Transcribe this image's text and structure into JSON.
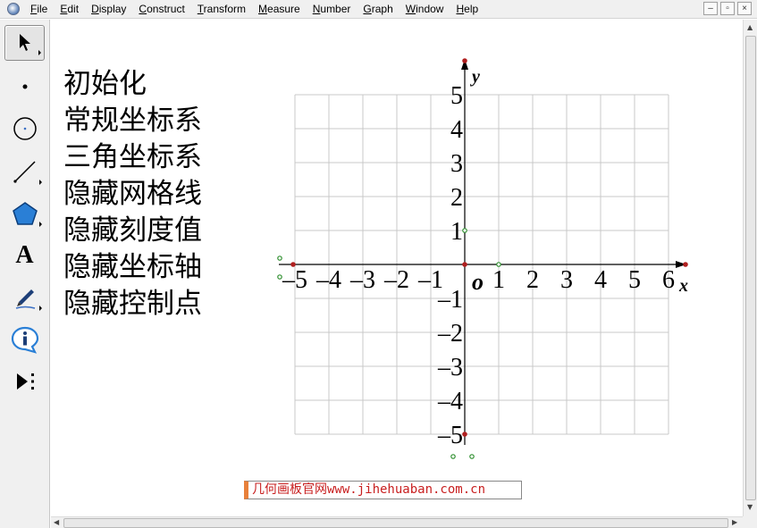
{
  "menu": {
    "items": [
      {
        "accel": "F",
        "rest": "ile"
      },
      {
        "accel": "E",
        "rest": "dit"
      },
      {
        "accel": "D",
        "rest": "isplay"
      },
      {
        "accel": "C",
        "rest": "onstruct"
      },
      {
        "accel": "T",
        "rest": "ransform"
      },
      {
        "accel": "M",
        "rest": "easure"
      },
      {
        "accel": "N",
        "rest": "umber"
      },
      {
        "accel": "G",
        "rest": "raph"
      },
      {
        "accel": "W",
        "rest": "indow"
      },
      {
        "accel": "H",
        "rest": "elp"
      }
    ],
    "window_controls": [
      "–",
      "▫",
      "×"
    ]
  },
  "toolbox": {
    "tools": [
      {
        "name": "arrow-tool",
        "icon": "arrow-select-icon",
        "selected": true
      },
      {
        "name": "point-tool",
        "icon": "point-icon"
      },
      {
        "name": "compass-tool",
        "icon": "circle-icon"
      },
      {
        "name": "straightedge-tool",
        "icon": "line-segment-icon"
      },
      {
        "name": "polygon-tool",
        "icon": "pentagon-icon"
      },
      {
        "name": "text-tool",
        "icon": "text-a-icon",
        "glyph": "A"
      },
      {
        "name": "marker-tool",
        "icon": "pen-marker-icon"
      },
      {
        "name": "information-tool",
        "icon": "info-icon",
        "glyph": "i"
      },
      {
        "name": "custom-tools",
        "icon": "custom-tool-icon"
      }
    ]
  },
  "action_buttons": [
    "初始化",
    "常规坐标系",
    "三角坐标系",
    "隐藏网格线",
    "隐藏刻度值",
    "隐藏坐标轴",
    "隐藏控制点"
  ],
  "graph": {
    "x_tick_labels": [
      "–5",
      "–4",
      "–3",
      "–2",
      "–1",
      "1",
      "2",
      "3",
      "4",
      "5",
      "6"
    ],
    "x_tick_values": [
      -5,
      -4,
      -3,
      -2,
      -1,
      1,
      2,
      3,
      4,
      5,
      6
    ],
    "y_tick_labels": [
      "5",
      "4",
      "3",
      "2",
      "1",
      "–1",
      "–2",
      "–3",
      "–4",
      "–5"
    ],
    "y_tick_values": [
      5,
      4,
      3,
      2,
      1,
      -1,
      -2,
      -3,
      -4,
      -5
    ],
    "origin_label": "o",
    "x_axis_label": "x",
    "y_axis_label": "y",
    "grid_x_range": [
      -5,
      6
    ],
    "grid_y_range": [
      -5,
      5
    ],
    "colors": {
      "grid": "#c8c8c8",
      "axis": "#000000",
      "control_point_red": "#b02020",
      "control_point_green": "#2f8f2f"
    }
  },
  "watermark": "几何画板官网www.jihehuaban.com.cn"
}
